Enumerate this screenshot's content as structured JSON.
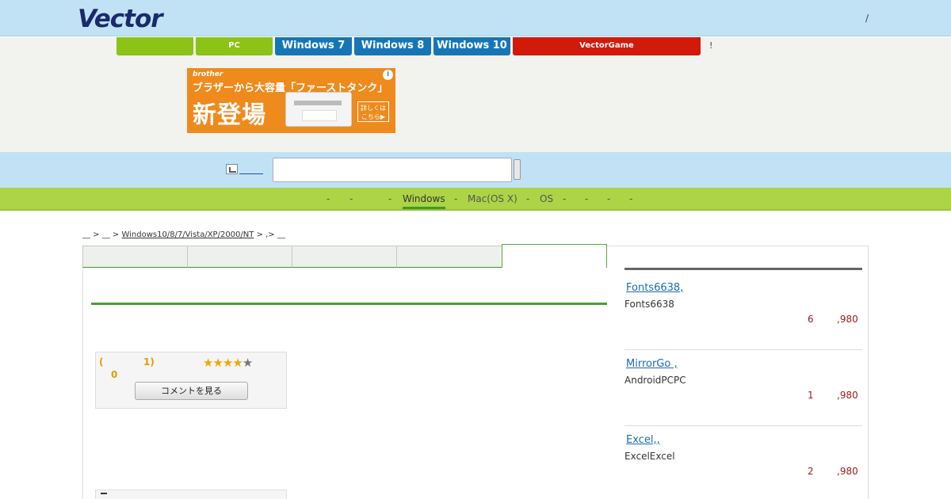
{
  "header": {
    "logo": "Vector",
    "right_text": "/"
  },
  "tabs": [
    {
      "label": ""
    },
    {
      "label": "PC"
    },
    {
      "label": "Windows 7"
    },
    {
      "label": "Windows 8"
    },
    {
      "label": "Windows 10"
    },
    {
      "label": "VectorGame"
    }
  ],
  "tab_note": "!",
  "ad": {
    "brand": "brother",
    "headline": "ブラザーから大容量「ファーストタンク」",
    "big": "新登場",
    "button": "詳しくは\nこちら▶",
    "info": "i"
  },
  "search": {
    "placeholder": "",
    "value": ""
  },
  "nav": [
    {
      "label": "-"
    },
    {
      "label": "-"
    },
    {
      "label": "-"
    },
    {
      "label": "Windows"
    },
    {
      "label": "-"
    },
    {
      "label": "Mac(OS X)"
    },
    {
      "label": "-"
    },
    {
      "label": "OS"
    },
    {
      "label": "-"
    },
    {
      "label": "-"
    },
    {
      "label": "-"
    },
    {
      "label": "-"
    }
  ],
  "breadcrumb": {
    "p1": "__ > __ >",
    "link": "Windows10/8/7/Vista/XP/2000/NT",
    "p2": "> ,> __"
  },
  "rating": {
    "paren_open": "(",
    "count": "1)",
    "zero": "0",
    "stars": 4,
    "comment_button": "コメントを見る"
  },
  "ranking": [
    {
      "title": "Fonts6638,",
      "desc": "Fonts6638",
      "rank": "6",
      "price": ",980"
    },
    {
      "title": "MirrorGo ,",
      "desc": "AndroidPCPC",
      "rank": "1",
      "price": ",980"
    },
    {
      "title": "Excel,,",
      "desc": "ExcelExcel",
      "rank": "2",
      "price": ",980"
    }
  ]
}
